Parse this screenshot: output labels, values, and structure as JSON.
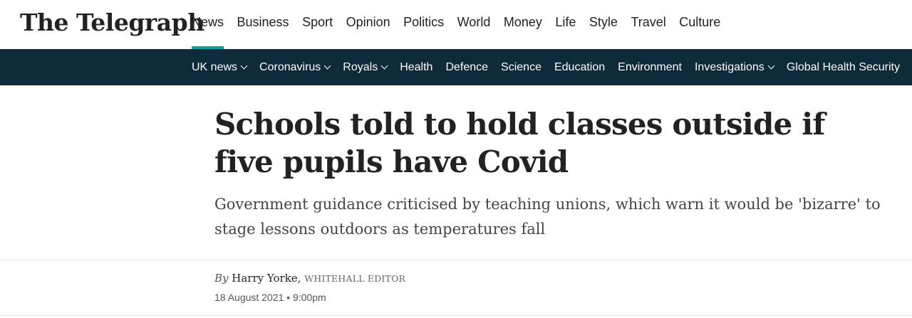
{
  "header": {
    "logo": "The Telegraph",
    "primary_nav": [
      {
        "label": "News",
        "active": true
      },
      {
        "label": "Business"
      },
      {
        "label": "Sport"
      },
      {
        "label": "Opinion"
      },
      {
        "label": "Politics"
      },
      {
        "label": "World"
      },
      {
        "label": "Money"
      },
      {
        "label": "Life"
      },
      {
        "label": "Style"
      },
      {
        "label": "Travel"
      },
      {
        "label": "Culture"
      }
    ],
    "secondary_nav": [
      {
        "label": "UK news",
        "dropdown": true
      },
      {
        "label": "Coronavirus",
        "dropdown": true
      },
      {
        "label": "Royals",
        "dropdown": true
      },
      {
        "label": "Health"
      },
      {
        "label": "Defence"
      },
      {
        "label": "Science"
      },
      {
        "label": "Education"
      },
      {
        "label": "Environment"
      },
      {
        "label": "Investigations",
        "dropdown": true
      },
      {
        "label": "Global Health Security"
      }
    ]
  },
  "article": {
    "headline": "Schools told to hold classes outside if five pupils have Covid",
    "standfirst": "Government guidance criticised by teaching unions, which warn it would be 'bizarre' to stage lessons outdoors as temperatures fall",
    "byline": {
      "prefix": "By",
      "author": "Harry Yorke,",
      "role": "WHITEHALL EDITOR"
    },
    "date": "18 August 2021 • 9:00pm"
  },
  "colors": {
    "active_underline": "#05a39b",
    "secondary_nav_bg": "#0d2a3a"
  }
}
